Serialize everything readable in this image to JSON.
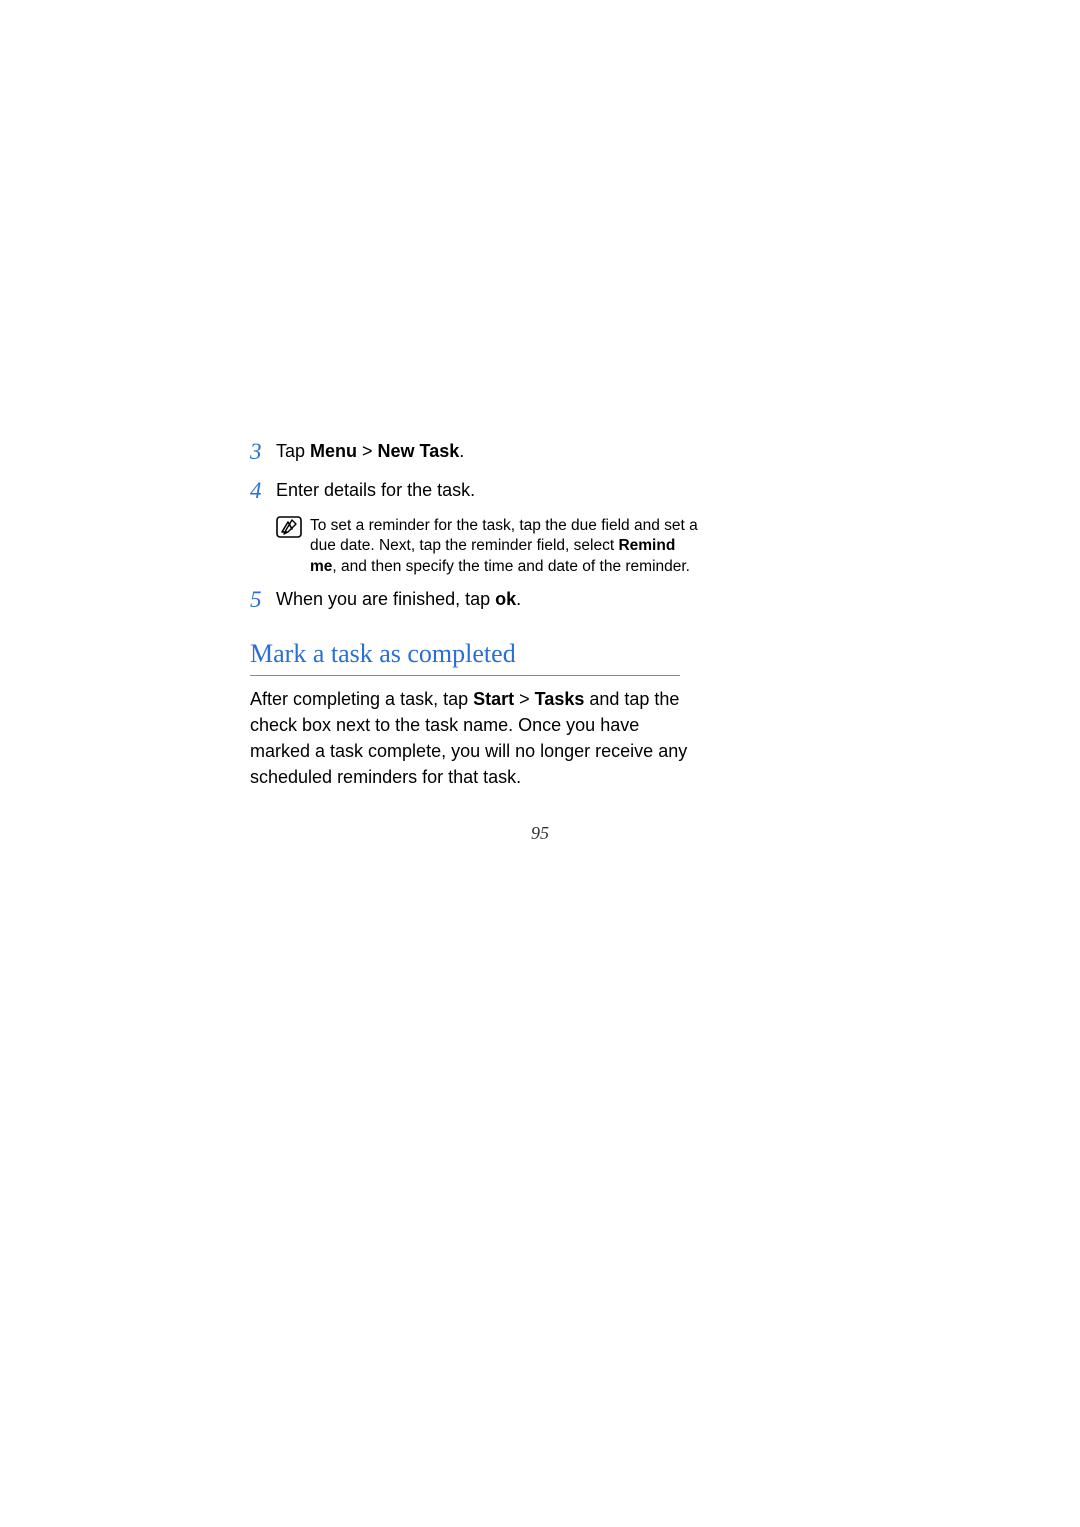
{
  "steps": {
    "s3": {
      "num": "3",
      "pre": "Tap ",
      "b1": "Menu",
      "mid": " > ",
      "b2": "New Task",
      "post": "."
    },
    "s4": {
      "num": "4",
      "text": "Enter details for the task."
    },
    "note": {
      "pre": "To set a reminder for the task, tap the due field and set a due date. Next, tap the reminder field, select ",
      "b1": "Remind me",
      "post": ", and then specify the time and date of the reminder."
    },
    "s5": {
      "num": "5",
      "pre": "When you are finished, tap ",
      "b1": "ok",
      "post": "."
    }
  },
  "heading": "Mark a task as completed",
  "para": {
    "pre": "After completing a task, tap ",
    "b1": "Start",
    "mid": " > ",
    "b2": "Tasks",
    "post": " and tap the check box next to the task name. Once you have marked a task complete, you will no longer receive any scheduled reminders for that task."
  },
  "page_number": "95"
}
